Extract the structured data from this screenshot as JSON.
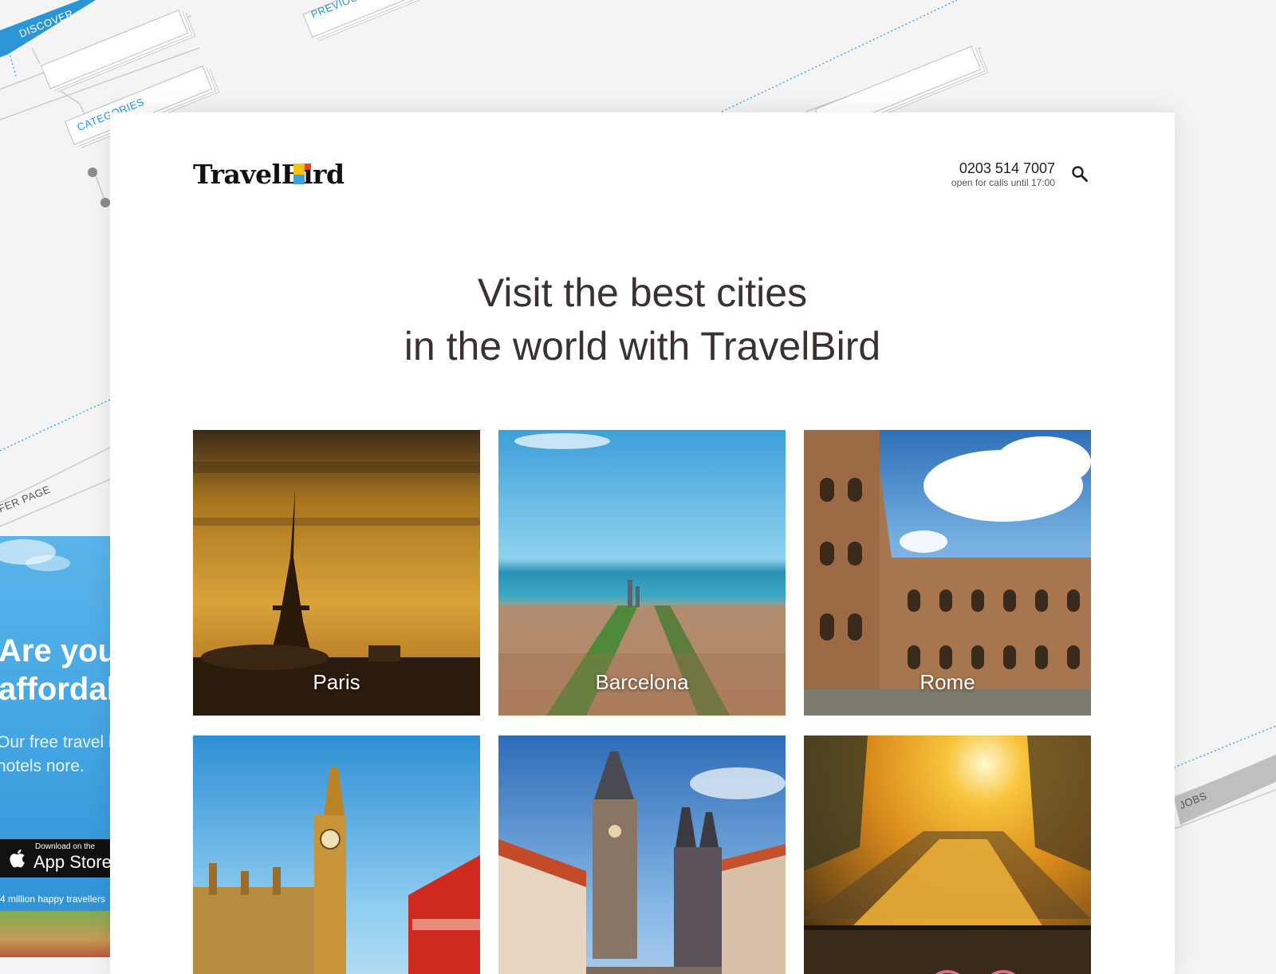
{
  "background": {
    "sitemap_labels": [
      "DISCOVER",
      "PREVIOUS",
      "CATEGORIES",
      "FER PAGE",
      "JOBS"
    ]
  },
  "promo": {
    "headline": "Are you affordal",
    "subtext": "Our free travel he best hotels nore.",
    "appstore_small": "Download on the",
    "appstore_big": "App Store",
    "footer": "4 million happy travellers"
  },
  "header": {
    "logo_text": "TravelBird",
    "phone": "0203 514 7007",
    "hours": "open for calls until 17:00",
    "search_icon": "search-icon"
  },
  "main": {
    "headline_line1": "Visit the best cities",
    "headline_line2": "in the world with TravelBird",
    "cities": [
      {
        "name": "Paris"
      },
      {
        "name": "Barcelona"
      },
      {
        "name": "Rome"
      },
      {
        "name": ""
      },
      {
        "name": ""
      },
      {
        "name": ""
      }
    ]
  },
  "colors": {
    "accent_blue": "#2b96d6",
    "headline": "#3a3230",
    "logo_yellow": "#f6c40f",
    "logo_blue": "#3aa3e0"
  }
}
